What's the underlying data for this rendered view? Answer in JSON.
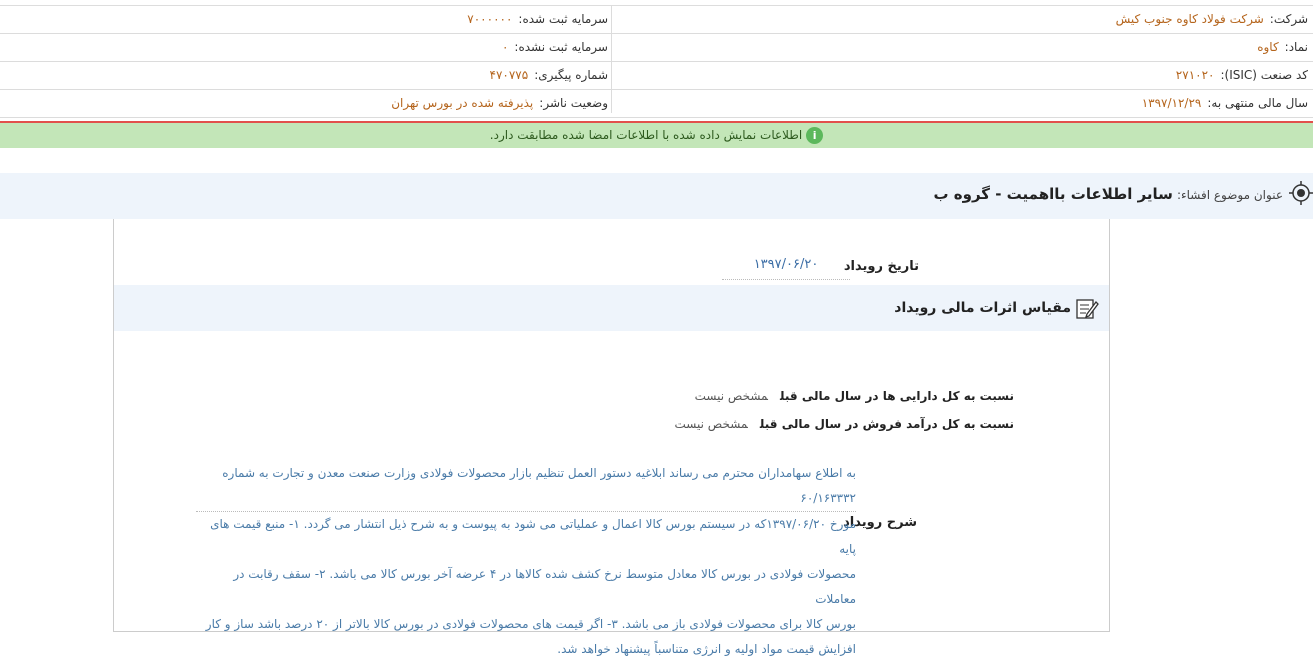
{
  "header": {
    "company_label": "شرکت:",
    "company_value": "شرکت فولاد کاوه جنوب کیش",
    "registered_capital_label": "سرمایه ثبت شده:",
    "registered_capital_value": "۷۰۰۰۰۰۰",
    "symbol_label": "نماد:",
    "symbol_value": "کاوه",
    "unregistered_capital_label": "سرمایه ثبت نشده:",
    "unregistered_capital_value": "۰",
    "isic_label": "کد صنعت (ISIC):",
    "isic_value": "۲۷۱۰۲۰",
    "tracking_label": "شماره پیگیری:",
    "tracking_value": "۴۷۰۷۷۵",
    "fiscal_year_label": "سال مالی منتهی به:",
    "fiscal_year_value": "۱۳۹۷/۱۲/۲۹",
    "publisher_status_label": "وضعیت ناشر:",
    "publisher_status_value": "پذیرفته شده در بورس تهران"
  },
  "notice": {
    "icon": "info-icon",
    "text": "اطلاعات نمایش داده شده با اطلاعات امضا شده مطابقت دارد."
  },
  "subject": {
    "label": "عنوان موضوع افشاء:",
    "title": "سایر اطلاعات بااهمیت - گروه ب"
  },
  "event": {
    "date_label": "تاریخ رویداد",
    "date_value": "۱۳۹۷/۰۶/۲۰",
    "section_title": "مقیاس اثرات مالی رویداد",
    "ratio_assets_label": "نسبت به کل دارایی ها در سال مالی قبل",
    "ratio_assets_value": "مشخص نیست",
    "ratio_revenue_label": "نسبت به کل درآمد فروش در سال مالی قبل",
    "ratio_revenue_value": "مشخص نیست",
    "description_label": "شرح رویداد",
    "description_lines": [
      "به اطلاع سهامداران محترم می رساند ابلاغیه دستور العمل تنظیم بازار محصولات فولادی وزارت صنعت معدن و تجارت به شماره ۶۰/۱۶۳۳۳۲",
      "مورخ ۱۳۹۷/۰۶/۲۰که در سیستم بورس کالا اعمال و عملیاتی می شود به پیوست و به شرح ذیل انتشار می گردد. ۱- منبع قیمت های پایه",
      "محصولات فولادی در بورس کالا معادل متوسط نرخ کشف شده کالاها در ۴ عرضه آخر بورس کالا می باشد. ۲- سقف رقابت در معاملات",
      "بورس کالا برای محصولات فولادی باز می باشد. ۳- اگر قیمت های محصولات فولادی در بورس کالا بالاتر از ۲۰ درصد باشد ساز و کار",
      "افزایش قیمت مواد اولیه و انرژی متناسباً پیشنهاد خواهد شد."
    ]
  },
  "colors": {
    "value_text": "#b5651d",
    "notice_bg": "#c3e6b8",
    "alert_line": "#e2504c",
    "description_text": "#4a7ba8",
    "section_bg": "#eef4fb"
  }
}
